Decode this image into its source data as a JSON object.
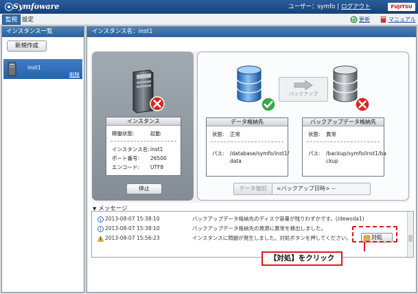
{
  "header": {
    "brand": "Symfoware",
    "user_label": "ユーザー：",
    "user_name": "symfo",
    "separator": "|",
    "logout": "ログアウト",
    "vendor_logo": "FUJITSU"
  },
  "tabs": {
    "monitor": "監視",
    "settings": "設定"
  },
  "toolbar": {
    "refresh": "更新",
    "manual": "マニュアル"
  },
  "sidebar": {
    "title": "インスタンス一覧",
    "new_button": "新規作成",
    "instances": [
      {
        "name": "inst1",
        "delete": "削除"
      }
    ]
  },
  "main": {
    "title": "インスタンス名：inst1"
  },
  "instance": {
    "title": "インスタンス",
    "status_label": "稼働状態:",
    "status_value": "起動",
    "name_label": "インスタンス名:",
    "name_value": "inst1",
    "port_label": "ポート番号:",
    "port_value": "26500",
    "encoding_label": "エンコード:",
    "encoding_value": "UTF8",
    "stop_button": "停止",
    "status_icon": "error-x-icon"
  },
  "data_storage": {
    "title": "データ格納先",
    "status_label": "状態:",
    "status_value": "正常",
    "path_label": "パス:",
    "path_value_1": "/database/symfo/inst1/",
    "path_value_2": "data",
    "status_icon": "ok-check-icon"
  },
  "backup_storage": {
    "title": "バックアップデータ格納先",
    "status_label": "状態:",
    "status_value": "異常",
    "path_label": "パス:",
    "path_value_1": "/backup/symfo/inst1/ba",
    "path_value_2": "ckup",
    "status_icon": "error-x-icon"
  },
  "backup_button": "バックアップ",
  "restore": {
    "button": "データ復旧",
    "datetime": "<バックアップ日時> --"
  },
  "messages": {
    "title": "メッセージ",
    "items": [
      {
        "level": "info",
        "datetime": "2013-08-07 15:38:10",
        "text": "バックアップデータ格納先のディスク容量が残りわずかです。(/dewsda1)"
      },
      {
        "level": "info",
        "datetime": "2013-08-07 15:38:10",
        "text": "バックアップデータ格納先の資源に異常を検出しました。"
      },
      {
        "level": "warning",
        "datetime": "2013-08-07 15:56:23",
        "text": "インスタンスに問題が発生しました。対処ボタンを押してください。"
      }
    ],
    "action_button": "対処"
  },
  "callout": {
    "label": "【対処】をクリック"
  },
  "colors": {
    "header": "#17427a",
    "selected": "#2463ad",
    "error": "#d8261f",
    "ok": "#3aa845",
    "callout": "#e2141b"
  }
}
